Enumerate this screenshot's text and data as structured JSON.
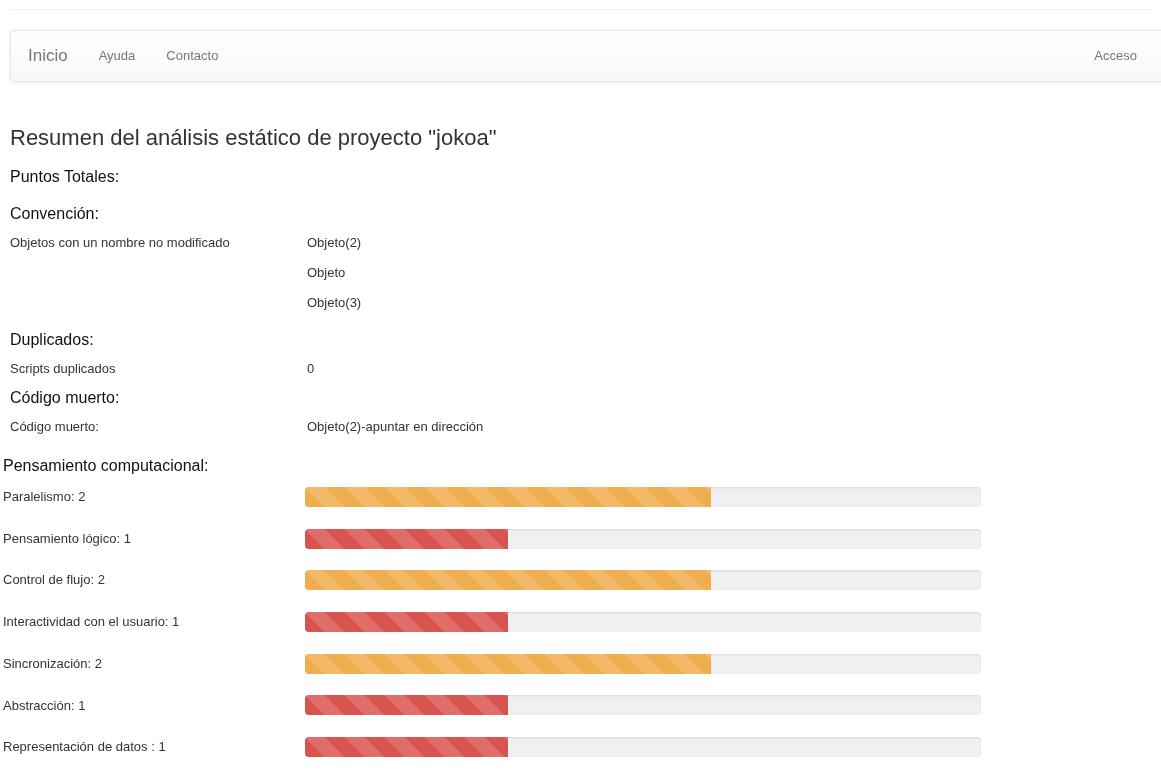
{
  "navbar": {
    "brand": "Inicio",
    "links": [
      "Ayuda",
      "Contacto"
    ],
    "right_link": "Acceso"
  },
  "title": "Resumen del análisis estático de proyecto \"jokoa\"",
  "total_points": "Puntos Totales:",
  "sections": [
    {
      "heading": "Convención:",
      "rows": [
        {
          "label": "Objetos con un nombre no modificado",
          "values": [
            "Objeto(2)",
            "Objeto",
            "Objeto(3)"
          ]
        }
      ]
    },
    {
      "heading": "Duplicados:",
      "rows": [
        {
          "label": "Scripts duplicados",
          "values": [
            "0"
          ]
        }
      ]
    },
    {
      "heading": "Código muerto:",
      "rows": [
        {
          "label": "Código muerto:",
          "values": [
            "Objeto(2)-apuntar en dirección"
          ]
        }
      ]
    }
  ],
  "computational": {
    "heading": "Pensamiento computacional:",
    "metrics": [
      {
        "label": "Paralelismo: 2",
        "level": 0.6,
        "color": "#f0ad4e"
      },
      {
        "label": "Pensamiento lógico: 1",
        "level": 0.3,
        "color": "#d9534f"
      },
      {
        "label": "Control de flujo: 2",
        "level": 0.6,
        "color": "#f0ad4e"
      },
      {
        "label": "Interactividad con el usuario: 1",
        "level": 0.3,
        "color": "#d9534f"
      },
      {
        "label": "Sincronización: 2",
        "level": 0.6,
        "color": "#f0ad4e"
      },
      {
        "label": "Abstracción: 1",
        "level": 0.3,
        "color": "#d9534f"
      },
      {
        "label": "Representación de datos : 1",
        "level": 0.3,
        "color": "#d9534f"
      }
    ]
  }
}
